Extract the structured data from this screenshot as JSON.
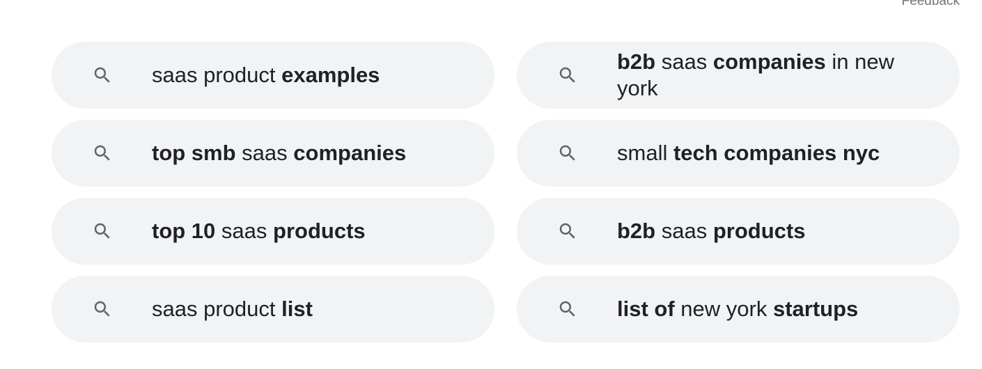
{
  "feedback_label": "Feedback",
  "icon": "search-icon",
  "colors": {
    "pill_bg": "#f1f3f4",
    "text": "#202124",
    "icon": "#5f6368",
    "muted": "#70757a"
  },
  "suggestions": [
    {
      "text": "saas product examples",
      "parts": [
        {
          "t": "saas product ",
          "b": false
        },
        {
          "t": "examples",
          "b": true
        }
      ]
    },
    {
      "text": "b2b saas companies in new york",
      "parts": [
        {
          "t": "b2b",
          "b": true
        },
        {
          "t": " saas ",
          "b": false
        },
        {
          "t": "companies",
          "b": true
        },
        {
          "t": " in new york",
          "b": false
        }
      ]
    },
    {
      "text": "top smb saas companies",
      "parts": [
        {
          "t": "top smb",
          "b": true
        },
        {
          "t": " saas ",
          "b": false
        },
        {
          "t": "companies",
          "b": true
        }
      ]
    },
    {
      "text": "small tech companies nyc",
      "parts": [
        {
          "t": "small ",
          "b": false
        },
        {
          "t": "tech companies nyc",
          "b": true
        }
      ]
    },
    {
      "text": "top 10 saas products",
      "parts": [
        {
          "t": "top 10",
          "b": true
        },
        {
          "t": " saas ",
          "b": false
        },
        {
          "t": "products",
          "b": true
        }
      ]
    },
    {
      "text": "b2b saas products",
      "parts": [
        {
          "t": "b2b",
          "b": true
        },
        {
          "t": " saas ",
          "b": false
        },
        {
          "t": "products",
          "b": true
        }
      ]
    },
    {
      "text": "saas product list",
      "parts": [
        {
          "t": "saas product ",
          "b": false
        },
        {
          "t": "list",
          "b": true
        }
      ]
    },
    {
      "text": "list of new york startups",
      "parts": [
        {
          "t": "list of",
          "b": true
        },
        {
          "t": " new york ",
          "b": false
        },
        {
          "t": "startups",
          "b": true
        }
      ]
    }
  ]
}
